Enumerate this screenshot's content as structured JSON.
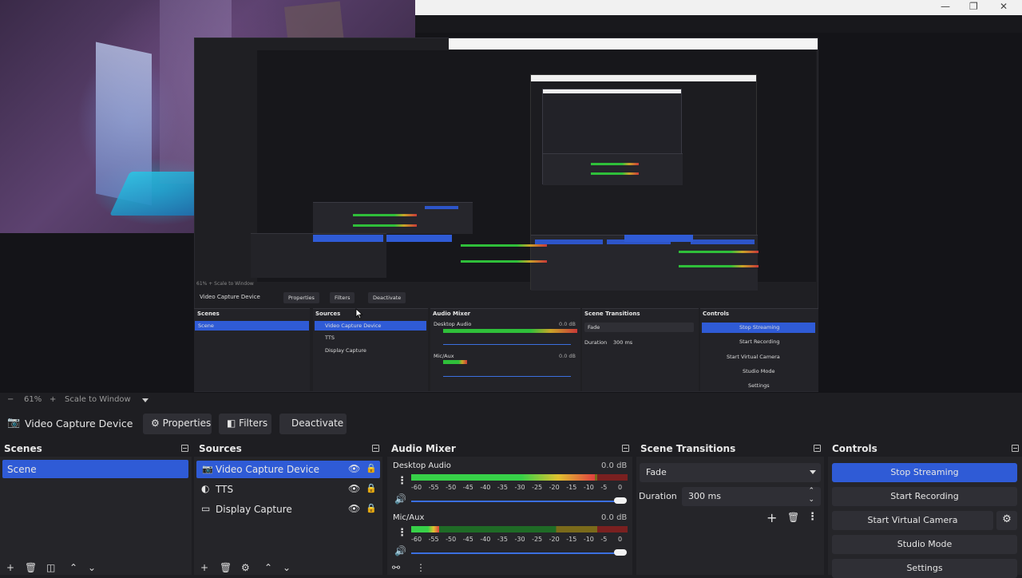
{
  "nested": {
    "scale_text": "61% + Scale to Window",
    "source_name": "Video Capture Device",
    "properties": "Properties",
    "filters": "Filters",
    "deactivate": "Deactivate",
    "scenes": "Scenes",
    "sources": "Sources",
    "audio_mixer": "Audio Mixer",
    "scene_transitions": "Scene Transitions",
    "controls": "Controls",
    "scene_item": "Scene",
    "source_items": [
      "Video Capture Device",
      "TTS",
      "Display Capture"
    ],
    "desktop_audio": "Desktop Audio",
    "mic_aux": "Mic/Aux",
    "db": "0.0 dB",
    "fade": "Fade",
    "duration_label": "Duration",
    "duration_value": "300 ms",
    "ctrl": [
      "Stop Streaming",
      "Start Recording",
      "Start Virtual Camera",
      "Studio Mode",
      "Settings"
    ]
  },
  "scale_bar": {
    "minus": "−",
    "zoom": "61%",
    "plus": "+",
    "mode": "Scale to Window"
  },
  "source_toolbar": {
    "source_name": "Video Capture Device",
    "properties": "Properties",
    "filters": "Filters",
    "deactivate": "Deactivate"
  },
  "scenes": {
    "title": "Scenes",
    "items": [
      "Scene"
    ]
  },
  "sources": {
    "title": "Sources",
    "items": [
      "Video Capture Device",
      "TTS",
      "Display Capture"
    ]
  },
  "audio_mixer": {
    "title": "Audio Mixer",
    "channels": [
      {
        "name": "Desktop Audio",
        "db": "0.0 dB",
        "level": 0.85
      },
      {
        "name": "Mic/Aux",
        "db": "0.0 dB",
        "level": 0.13
      }
    ],
    "ticks": [
      "-60",
      "-55",
      "-50",
      "-45",
      "-40",
      "-35",
      "-30",
      "-25",
      "-20",
      "-15",
      "-10",
      "-5",
      "0"
    ]
  },
  "scene_transitions": {
    "title": "Scene Transitions",
    "transition": "Fade",
    "duration_label": "Duration",
    "duration_value": "300 ms"
  },
  "controls": {
    "title": "Controls",
    "stop_streaming": "Stop Streaming",
    "start_recording": "Start Recording",
    "start_virtual_camera": "Start Virtual Camera",
    "studio_mode": "Studio Mode",
    "settings": "Settings"
  },
  "colors": {
    "accent": "#2f5bd6",
    "meter_green": "#37d148",
    "meter_yellow": "#e0c230",
    "meter_red": "#e04040"
  }
}
